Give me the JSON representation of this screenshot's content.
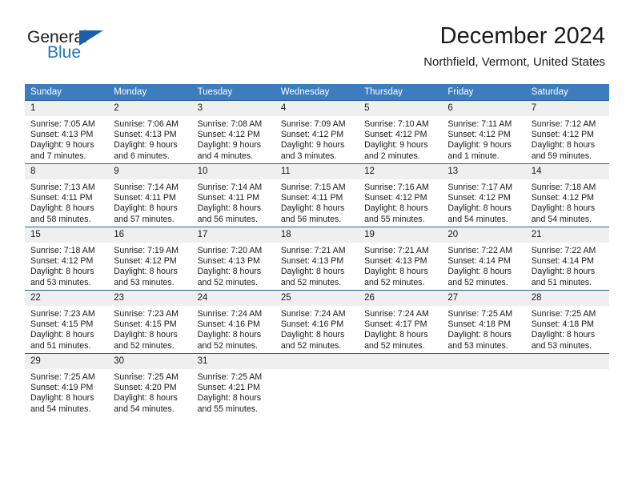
{
  "brand": {
    "name_top": "General",
    "name_bottom": "Blue",
    "accent_color": "#1a5fa8",
    "blue_text_color": "#1f77bd"
  },
  "header": {
    "month_title": "December 2024",
    "location": "Northfield, Vermont, United States"
  },
  "theme": {
    "header_row_bg": "#3c7cbf",
    "row_border": "#2a6099",
    "daynum_bg": "#efefef"
  },
  "weekday_headers": [
    "Sunday",
    "Monday",
    "Tuesday",
    "Wednesday",
    "Thursday",
    "Friday",
    "Saturday"
  ],
  "weeks": [
    [
      {
        "day": "1",
        "sunrise": "Sunrise: 7:05 AM",
        "sunset": "Sunset: 4:13 PM",
        "daylight_line1": "Daylight: 9 hours",
        "daylight_line2": "and 7 minutes."
      },
      {
        "day": "2",
        "sunrise": "Sunrise: 7:06 AM",
        "sunset": "Sunset: 4:13 PM",
        "daylight_line1": "Daylight: 9 hours",
        "daylight_line2": "and 6 minutes."
      },
      {
        "day": "3",
        "sunrise": "Sunrise: 7:08 AM",
        "sunset": "Sunset: 4:12 PM",
        "daylight_line1": "Daylight: 9 hours",
        "daylight_line2": "and 4 minutes."
      },
      {
        "day": "4",
        "sunrise": "Sunrise: 7:09 AM",
        "sunset": "Sunset: 4:12 PM",
        "daylight_line1": "Daylight: 9 hours",
        "daylight_line2": "and 3 minutes."
      },
      {
        "day": "5",
        "sunrise": "Sunrise: 7:10 AM",
        "sunset": "Sunset: 4:12 PM",
        "daylight_line1": "Daylight: 9 hours",
        "daylight_line2": "and 2 minutes."
      },
      {
        "day": "6",
        "sunrise": "Sunrise: 7:11 AM",
        "sunset": "Sunset: 4:12 PM",
        "daylight_line1": "Daylight: 9 hours",
        "daylight_line2": "and 1 minute."
      },
      {
        "day": "7",
        "sunrise": "Sunrise: 7:12 AM",
        "sunset": "Sunset: 4:12 PM",
        "daylight_line1": "Daylight: 8 hours",
        "daylight_line2": "and 59 minutes."
      }
    ],
    [
      {
        "day": "8",
        "sunrise": "Sunrise: 7:13 AM",
        "sunset": "Sunset: 4:11 PM",
        "daylight_line1": "Daylight: 8 hours",
        "daylight_line2": "and 58 minutes."
      },
      {
        "day": "9",
        "sunrise": "Sunrise: 7:14 AM",
        "sunset": "Sunset: 4:11 PM",
        "daylight_line1": "Daylight: 8 hours",
        "daylight_line2": "and 57 minutes."
      },
      {
        "day": "10",
        "sunrise": "Sunrise: 7:14 AM",
        "sunset": "Sunset: 4:11 PM",
        "daylight_line1": "Daylight: 8 hours",
        "daylight_line2": "and 56 minutes."
      },
      {
        "day": "11",
        "sunrise": "Sunrise: 7:15 AM",
        "sunset": "Sunset: 4:11 PM",
        "daylight_line1": "Daylight: 8 hours",
        "daylight_line2": "and 56 minutes."
      },
      {
        "day": "12",
        "sunrise": "Sunrise: 7:16 AM",
        "sunset": "Sunset: 4:12 PM",
        "daylight_line1": "Daylight: 8 hours",
        "daylight_line2": "and 55 minutes."
      },
      {
        "day": "13",
        "sunrise": "Sunrise: 7:17 AM",
        "sunset": "Sunset: 4:12 PM",
        "daylight_line1": "Daylight: 8 hours",
        "daylight_line2": "and 54 minutes."
      },
      {
        "day": "14",
        "sunrise": "Sunrise: 7:18 AM",
        "sunset": "Sunset: 4:12 PM",
        "daylight_line1": "Daylight: 8 hours",
        "daylight_line2": "and 54 minutes."
      }
    ],
    [
      {
        "day": "15",
        "sunrise": "Sunrise: 7:18 AM",
        "sunset": "Sunset: 4:12 PM",
        "daylight_line1": "Daylight: 8 hours",
        "daylight_line2": "and 53 minutes."
      },
      {
        "day": "16",
        "sunrise": "Sunrise: 7:19 AM",
        "sunset": "Sunset: 4:12 PM",
        "daylight_line1": "Daylight: 8 hours",
        "daylight_line2": "and 53 minutes."
      },
      {
        "day": "17",
        "sunrise": "Sunrise: 7:20 AM",
        "sunset": "Sunset: 4:13 PM",
        "daylight_line1": "Daylight: 8 hours",
        "daylight_line2": "and 52 minutes."
      },
      {
        "day": "18",
        "sunrise": "Sunrise: 7:21 AM",
        "sunset": "Sunset: 4:13 PM",
        "daylight_line1": "Daylight: 8 hours",
        "daylight_line2": "and 52 minutes."
      },
      {
        "day": "19",
        "sunrise": "Sunrise: 7:21 AM",
        "sunset": "Sunset: 4:13 PM",
        "daylight_line1": "Daylight: 8 hours",
        "daylight_line2": "and 52 minutes."
      },
      {
        "day": "20",
        "sunrise": "Sunrise: 7:22 AM",
        "sunset": "Sunset: 4:14 PM",
        "daylight_line1": "Daylight: 8 hours",
        "daylight_line2": "and 52 minutes."
      },
      {
        "day": "21",
        "sunrise": "Sunrise: 7:22 AM",
        "sunset": "Sunset: 4:14 PM",
        "daylight_line1": "Daylight: 8 hours",
        "daylight_line2": "and 51 minutes."
      }
    ],
    [
      {
        "day": "22",
        "sunrise": "Sunrise: 7:23 AM",
        "sunset": "Sunset: 4:15 PM",
        "daylight_line1": "Daylight: 8 hours",
        "daylight_line2": "and 51 minutes."
      },
      {
        "day": "23",
        "sunrise": "Sunrise: 7:23 AM",
        "sunset": "Sunset: 4:15 PM",
        "daylight_line1": "Daylight: 8 hours",
        "daylight_line2": "and 52 minutes."
      },
      {
        "day": "24",
        "sunrise": "Sunrise: 7:24 AM",
        "sunset": "Sunset: 4:16 PM",
        "daylight_line1": "Daylight: 8 hours",
        "daylight_line2": "and 52 minutes."
      },
      {
        "day": "25",
        "sunrise": "Sunrise: 7:24 AM",
        "sunset": "Sunset: 4:16 PM",
        "daylight_line1": "Daylight: 8 hours",
        "daylight_line2": "and 52 minutes."
      },
      {
        "day": "26",
        "sunrise": "Sunrise: 7:24 AM",
        "sunset": "Sunset: 4:17 PM",
        "daylight_line1": "Daylight: 8 hours",
        "daylight_line2": "and 52 minutes."
      },
      {
        "day": "27",
        "sunrise": "Sunrise: 7:25 AM",
        "sunset": "Sunset: 4:18 PM",
        "daylight_line1": "Daylight: 8 hours",
        "daylight_line2": "and 53 minutes."
      },
      {
        "day": "28",
        "sunrise": "Sunrise: 7:25 AM",
        "sunset": "Sunset: 4:18 PM",
        "daylight_line1": "Daylight: 8 hours",
        "daylight_line2": "and 53 minutes."
      }
    ],
    [
      {
        "day": "29",
        "sunrise": "Sunrise: 7:25 AM",
        "sunset": "Sunset: 4:19 PM",
        "daylight_line1": "Daylight: 8 hours",
        "daylight_line2": "and 54 minutes."
      },
      {
        "day": "30",
        "sunrise": "Sunrise: 7:25 AM",
        "sunset": "Sunset: 4:20 PM",
        "daylight_line1": "Daylight: 8 hours",
        "daylight_line2": "and 54 minutes."
      },
      {
        "day": "31",
        "sunrise": "Sunrise: 7:25 AM",
        "sunset": "Sunset: 4:21 PM",
        "daylight_line1": "Daylight: 8 hours",
        "daylight_line2": "and 55 minutes."
      },
      {
        "day": "",
        "sunrise": "",
        "sunset": "",
        "daylight_line1": "",
        "daylight_line2": ""
      },
      {
        "day": "",
        "sunrise": "",
        "sunset": "",
        "daylight_line1": "",
        "daylight_line2": ""
      },
      {
        "day": "",
        "sunrise": "",
        "sunset": "",
        "daylight_line1": "",
        "daylight_line2": ""
      },
      {
        "day": "",
        "sunrise": "",
        "sunset": "",
        "daylight_line1": "",
        "daylight_line2": ""
      }
    ]
  ]
}
